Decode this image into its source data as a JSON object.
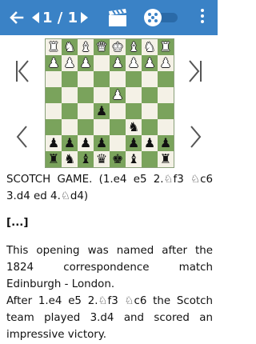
{
  "appbar": {
    "back_icon": "arrow-left-icon",
    "counter": "1 / 1",
    "video_icon": "clapperboard-icon",
    "toggle_icon": "cube-toggle-icon",
    "menu_icon": "more-vertical-icon"
  },
  "controls": {
    "first": "skip-to-start-icon",
    "last": "skip-to-end-icon",
    "prev": "chevron-left-icon",
    "next": "chevron-right-icon"
  },
  "board": {
    "ranks": [
      [
        "♜",
        "♞",
        "♝",
        "♛",
        "♚",
        "♝",
        "♞",
        "♜"
      ],
      [
        "♟",
        "♟",
        "♟",
        "♟",
        "",
        "♟",
        "♟",
        "♟"
      ],
      [
        "",
        "",
        "",
        "",
        "",
        "",
        "",
        ""
      ],
      [
        "",
        "",
        "",
        "",
        "♟",
        "",
        "",
        ""
      ],
      [
        "",
        "",
        "",
        "♙",
        "♙",
        "",
        "",
        ""
      ],
      [
        "",
        "",
        "",
        "",
        "",
        "",
        "",
        ""
      ],
      [
        "",
        "",
        "",
        "",
        "",
        "♘",
        "",
        ""
      ],
      [
        "♙",
        "♙",
        "♙",
        "",
        "",
        "♙",
        "♙",
        "♙"
      ]
    ],
    "ranks_white_pieces": [
      "bbbbbbbb",
      "bbbb.bbb",
      "........",
      "....b...",
      "...ww...",
      "........",
      ".....w..",
      "www..www"
    ],
    "board_view": [
      [
        "♖",
        "♘",
        "♗",
        "♕",
        "♔",
        "♗",
        "♘",
        "♖"
      ],
      [
        "♙",
        "♙",
        "♙",
        "",
        "♙",
        "♙",
        "♙",
        "♙"
      ],
      [
        "",
        "",
        "",
        "",
        "",
        "",
        "",
        ""
      ],
      [
        "",
        "",
        "",
        "",
        "♙",
        "",
        "",
        ""
      ],
      [
        "",
        "",
        "",
        "♟",
        "",
        "",
        "",
        ""
      ],
      [
        "",
        "",
        "",
        "",
        "",
        "♞",
        "",
        ""
      ],
      [
        "♟",
        "♟",
        "♟",
        "♟",
        "",
        "♟",
        "♟",
        "♟"
      ],
      [
        "♜",
        "♞",
        "♝",
        "♛",
        "♚",
        "♝",
        "",
        "♜"
      ]
    ]
  },
  "content": {
    "title": "SCOTCH GAME. (1.e4 e5 2.♘f3 ♘c6 3.d4 ed 4.♘d4)",
    "ellipsis": "[...]",
    "para1": "This opening was named after the 1824 correspondence match Edinburgh - London.",
    "para2": "After 1.e4 e5 2.♘f3 ♘c6 the Scotch team played 3.d4 and scored an impressive victory."
  }
}
